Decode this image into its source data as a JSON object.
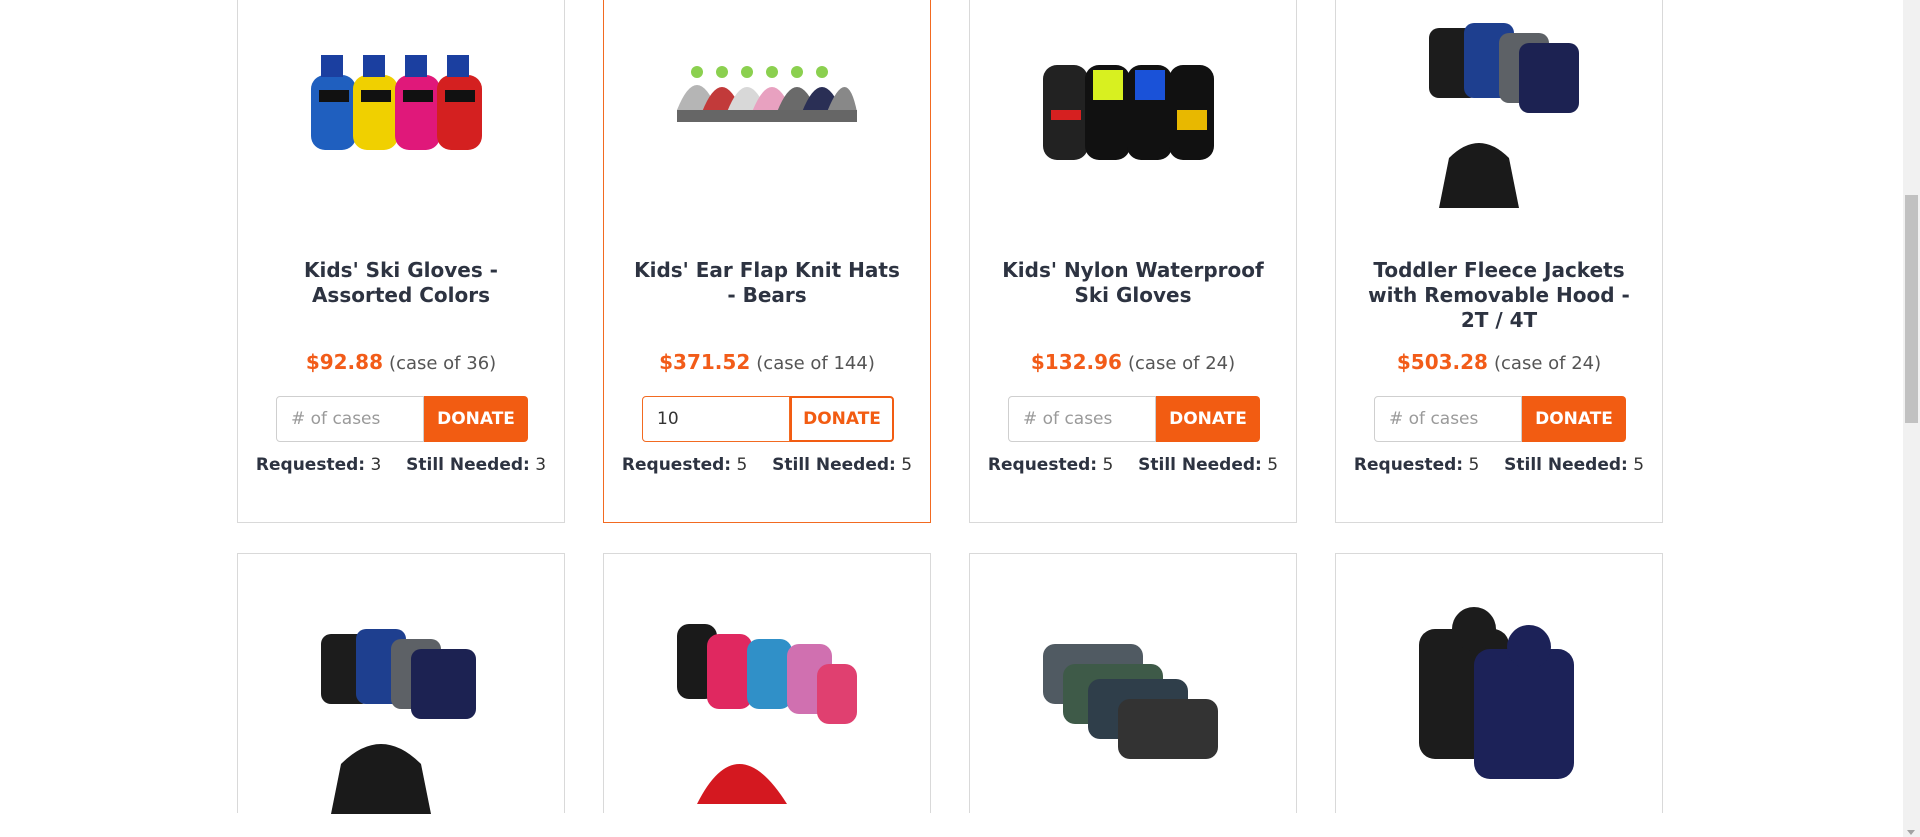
{
  "products": [
    {
      "title": "Kids' Ski Gloves - Assorted Colors",
      "price": "$92.88",
      "case": "(case of 36)",
      "qty_value": "",
      "qty_placeholder": "# of cases",
      "donate_label": "DONATE",
      "requested_label": "Requested:",
      "requested": "3",
      "still_needed_label": "Still Needed:",
      "still_needed": "3",
      "icon": "ski-gloves-image"
    },
    {
      "title": "Kids' Ear Flap Knit Hats - Bears",
      "price": "$371.52",
      "case": "(case of 144)",
      "qty_value": "10",
      "qty_placeholder": "# of cases",
      "donate_label": "DONATE",
      "requested_label": "Requested:",
      "requested": "5",
      "still_needed_label": "Still Needed:",
      "still_needed": "5",
      "icon": "knit-hats-image"
    },
    {
      "title": "Kids' Nylon Waterproof Ski Gloves",
      "price": "$132.96",
      "case": "(case of 24)",
      "qty_value": "",
      "qty_placeholder": "# of cases",
      "donate_label": "DONATE",
      "requested_label": "Requested:",
      "requested": "5",
      "still_needed_label": "Still Needed:",
      "still_needed": "5",
      "icon": "nylon-gloves-image"
    },
    {
      "title": "Toddler Fleece Jackets with Removable Hood - 2T / 4T",
      "price": "$503.28",
      "case": "(case of 24)",
      "qty_value": "",
      "qty_placeholder": "# of cases",
      "donate_label": "DONATE",
      "requested_label": "Requested:",
      "requested": "5",
      "still_needed_label": "Still Needed:",
      "still_needed": "5",
      "icon": "fleece-jackets-image"
    }
  ],
  "second_row": [
    {
      "icon": "hooded-jackets-image"
    },
    {
      "icon": "girls-puffer-jackets-image"
    },
    {
      "icon": "boys-puffer-jackets-image"
    },
    {
      "icon": "mens-puffer-jackets-image"
    }
  ],
  "colors": {
    "accent": "#f25c12",
    "price": "#f25c19",
    "border": "#d9d9d9"
  }
}
